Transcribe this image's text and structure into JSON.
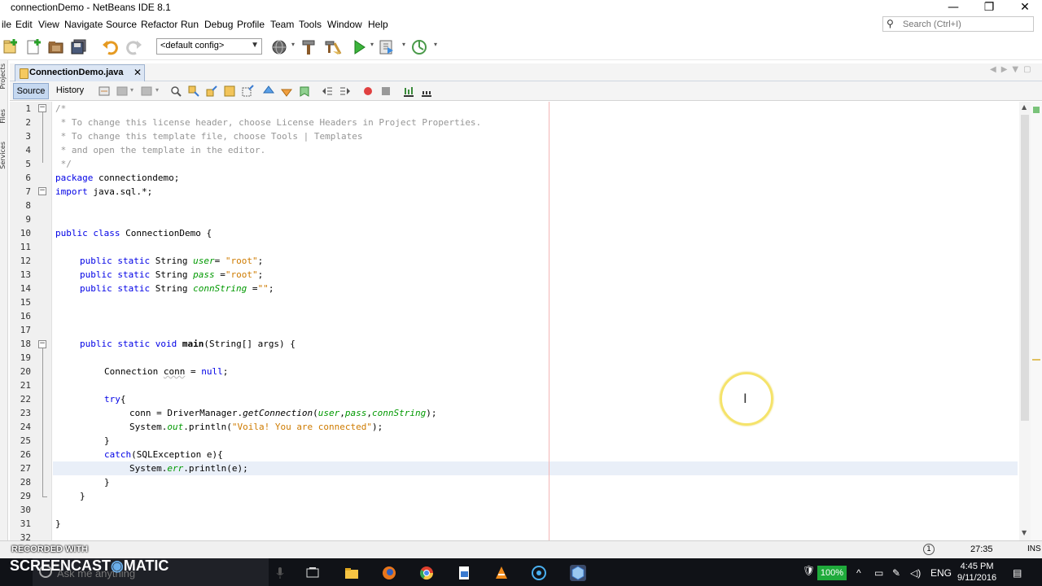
{
  "window": {
    "title": "connectionDemo - NetBeans IDE 8.1",
    "controls": {
      "minimize": "—",
      "restore": "❐",
      "close": "✕"
    }
  },
  "menu": [
    "ile",
    "Edit",
    "View",
    "Navigate",
    "Source",
    "Refactor",
    "Run",
    "Debug",
    "Profile",
    "Team",
    "Tools",
    "Window",
    "Help"
  ],
  "search": {
    "placeholder": "Search (Ctrl+I)"
  },
  "toolbar": {
    "config": "<default config>",
    "icons": [
      "new-project-icon",
      "new-file-icon",
      "open-project-icon",
      "save-all-icon",
      "undo-icon",
      "redo-icon",
      "config-dropdown",
      "globe-icon",
      "hammer-icon",
      "clean-build-icon",
      "run-icon",
      "debug-icon",
      "profile-icon"
    ]
  },
  "left_strip": [
    "Projects",
    "Files",
    "Services"
  ],
  "editor": {
    "tab": {
      "label": "ConnectionDemo.java",
      "close": "✕"
    },
    "source_label": "Source",
    "history_label": "History",
    "lines": [
      "1",
      "2",
      "3",
      "4",
      "5",
      "6",
      "7",
      "8",
      "9",
      "10",
      "11",
      "12",
      "13",
      "14",
      "15",
      "16",
      "17",
      "18",
      "19",
      "20",
      "21",
      "22",
      "23",
      "24",
      "25",
      "26",
      "27",
      "28",
      "29",
      "30",
      "31",
      "32"
    ],
    "code": {
      "l1": "/*",
      "l2": " * To change this license header, choose License Headers in Project Properties.",
      "l3": " * To change this template file, choose Tools | Templates",
      "l4": " * and open the template in the editor.",
      "l5": " */",
      "l6a": "package",
      "l6b": " connectiondemo;",
      "l7a": "import",
      "l7b": " java.sql.*;",
      "l10a": "public class",
      "l10b": " ConnectionDemo {",
      "l12a": "public static",
      "l12b": " String ",
      "l12c": "user",
      "l12d": "= ",
      "l12e": "\"root\"",
      "l12f": ";",
      "l13a": "public static",
      "l13b": " String ",
      "l13c": "pass",
      "l13d": " =",
      "l13e": "\"root\"",
      "l13f": ";",
      "l14a": "public static",
      "l14b": " String ",
      "l14c": "connString",
      "l14d": " =",
      "l14e": "\"\"",
      "l14f": ";",
      "l18a": "public static void",
      "l18b": " ",
      "l18c": "main",
      "l18d": "(String[] args) {",
      "l20a": "Connection ",
      "l20b": "conn",
      "l20c": " = ",
      "l20d": "null",
      "l20e": ";",
      "l22a": "try",
      "l22b": "{",
      "l23a": "conn = DriverManager.",
      "l23b": "getConnection",
      "l23c": "(",
      "l23d": "user",
      "l23e": ",",
      "l23f": "pass",
      "l23g": ",",
      "l23h": "connString",
      "l23i": ");",
      "l24a": "System.",
      "l24b": "out",
      "l24c": ".println(",
      "l24d": "\"Voila! You are connected\"",
      "l24e": ");",
      "l25": "}",
      "l26a": "catch",
      "l26b": "(SQLException e){",
      "l27a": "System.",
      "l27b": "err",
      "l27c": ".println(e);",
      "l28": "}",
      "l29": "}",
      "l31": "}"
    }
  },
  "status": {
    "recorded": "RECORDED WITH",
    "position": "27:35",
    "mode": "INS"
  },
  "taskbar": {
    "brand": "SCREENCAST",
    "brand_mid": "◉",
    "brand_end": "MATIC",
    "search_placeholder": "Ask me anything",
    "battery": "100%",
    "lang": "ENG",
    "time": "4:45 PM",
    "date": "9/11/2016"
  }
}
